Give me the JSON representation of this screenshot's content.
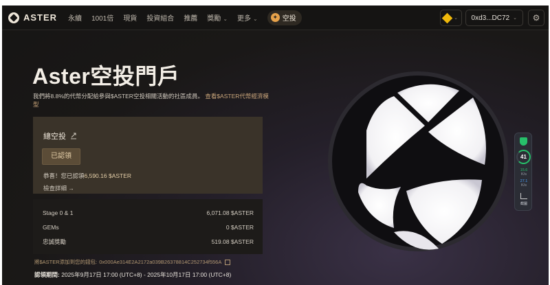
{
  "brand": {
    "name": "ASTER"
  },
  "nav": {
    "items": [
      {
        "label": "永續",
        "dropdown": false
      },
      {
        "label": "1001倍",
        "dropdown": false
      },
      {
        "label": "現貨",
        "dropdown": false
      },
      {
        "label": "投資組合",
        "dropdown": false
      },
      {
        "label": "推薦",
        "dropdown": false
      },
      {
        "label": "獎勵",
        "dropdown": true
      },
      {
        "label": "更多",
        "dropdown": true
      }
    ],
    "airdrop_label": "空投",
    "wallet_address": "0xd3...DC72"
  },
  "hero": {
    "title": "Aster空投門戶",
    "description": "我們將8.8%的代幣分配給參與$ASTER空投相關活動的社區成員。",
    "link_text": "查看$ASTER代幣經濟模型"
  },
  "card": {
    "title": "總空投",
    "badge": "已認領",
    "congrats_prefix": "恭喜！您已認領",
    "congrats_amount": "6,590.16 $ASTER",
    "check_details": "檢查詳細"
  },
  "breakdown": [
    {
      "label": "Stage 0 & 1",
      "value": "6,071.08 $ASTER"
    },
    {
      "label": "GEMs",
      "value": "0 $ASTER"
    },
    {
      "label": "忠誠獎勵",
      "value": "519.08 $ASTER"
    }
  ],
  "contract": {
    "label": "將$ASTER添加到您的錢包:",
    "address": "0x000Ae314E2A2172a039B26378814C252734f556A"
  },
  "claim_period": {
    "label": "認領期間:",
    "value": "2025年9月17日 17:00 (UTC+8) - 2025年10月17日 17:00 (UTC+8)"
  },
  "widget": {
    "score": "41",
    "upload_value": "15.6",
    "upload_unit": "K/s",
    "download_value": "27.1",
    "download_unit": "K/s",
    "graph_label": "截圖"
  },
  "colors": {
    "accent": "#c9a57a",
    "card_bg": "#3a3329",
    "widget_green": "#27c06a"
  }
}
